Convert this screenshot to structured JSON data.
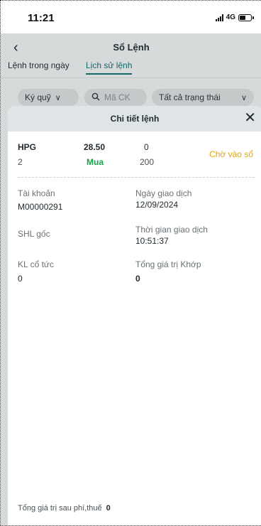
{
  "status_bar": {
    "time": "11:21",
    "network": "4G",
    "battery_level": 0.55
  },
  "background_screen": {
    "title": "Sổ Lệnh",
    "tabs": [
      {
        "label": "Lệnh trong ngày",
        "active": false
      },
      {
        "label": "Lịch sử lệnh",
        "active": true
      }
    ],
    "filters": {
      "account_type": "Ký quỹ",
      "search_placeholder": "Mã CK",
      "status": "Tất cả trạng thái"
    }
  },
  "sheet": {
    "title": "Chi tiết lệnh",
    "order": {
      "symbol": "HPG",
      "price": "28.50",
      "matched": "0",
      "quantity": "2",
      "side": "Mua",
      "volume": "200",
      "status": "Chờ vào sổ"
    },
    "details": {
      "account_label": "Tài khoản",
      "account_value": "M00000291",
      "trade_date_label": "Ngày giao dịch",
      "trade_date_value": "12/09/2024",
      "shl_label": "SHL gốc",
      "shl_value": "",
      "trade_time_label": "Thời gian giao dịch",
      "trade_time_value": "10:51:37",
      "dividend_label": "KL cổ tức",
      "dividend_value": "0",
      "total_matched_label": "Tổng giá trị Khớp",
      "total_matched_value": "0"
    },
    "footer": {
      "label": "Tổng giá trị sau phí,thuế",
      "value": "0"
    }
  },
  "colors": {
    "accent": "#116b6a",
    "buy": "#17a34a",
    "pending": "#e5a500",
    "overlay": "#d7dadb",
    "sheet_header": "#dfe4e6"
  }
}
